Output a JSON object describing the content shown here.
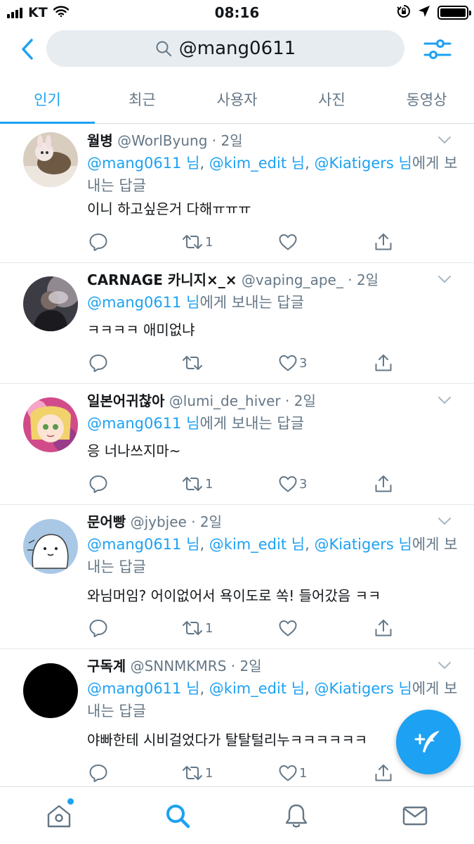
{
  "status_bar": {
    "carrier": "KT",
    "time": "08:16"
  },
  "search": {
    "query": "@mang0611"
  },
  "tabs": [
    {
      "label": "인기",
      "active": true
    },
    {
      "label": "최근",
      "active": false
    },
    {
      "label": "사용자",
      "active": false
    },
    {
      "label": "사진",
      "active": false
    },
    {
      "label": "동영상",
      "active": false
    }
  ],
  "tweets": [
    {
      "name": "월병",
      "handle": "@WorlByung",
      "time": "2일",
      "mentions": [
        "@mang0611",
        "@kim_edit",
        "@Kiatigers"
      ],
      "honorific": "님",
      "reply_suffix": "에게 보내는 답글",
      "text": "이니 하고싶은거 다해ㅠㅠㅠ",
      "replies": "",
      "retweets": "1",
      "likes": ""
    },
    {
      "name": "CARNAGE 카니지×_×",
      "handle": "@vaping_ape_",
      "time": "2일",
      "mentions": [
        "@mang0611"
      ],
      "honorific": "님",
      "reply_suffix": "에게 보내는 답글",
      "text": "ㅋㅋㅋㅋ 애미없냐",
      "replies": "",
      "retweets": "",
      "likes": "3"
    },
    {
      "name": "일본어귀찮아",
      "handle": "@lumi_de_hiver",
      "time": "2일",
      "mentions": [
        "@mang0611"
      ],
      "honorific": "님",
      "reply_suffix": "에게 보내는 답글",
      "text": "응 너나쓰지마~",
      "replies": "",
      "retweets": "1",
      "likes": "3"
    },
    {
      "name": "문어빵",
      "handle": "@jybjee",
      "time": "2일",
      "mentions": [
        "@mang0611",
        "@kim_edit",
        "@Kiatigers"
      ],
      "honorific": "님",
      "reply_suffix": "에게 보내는 답글",
      "text": "와님머임? 어이없어서 욕이도로 쏙! 들어갔음 ㅋㅋ",
      "replies": "",
      "retweets": "1",
      "likes": ""
    },
    {
      "name": "구독계",
      "handle": "@SNNMKMRS",
      "time": "2일",
      "mentions": [
        "@mang0611",
        "@kim_edit",
        "@Kiatigers"
      ],
      "honorific": "님",
      "reply_suffix": "에게 보내는 답글",
      "text": "야빠한테 시비걸었다가 탈탈털리누ㅋㅋㅋㅋㅋㅋ",
      "replies": "",
      "retweets": "1",
      "likes": "1"
    }
  ],
  "bottom_nav": [
    {
      "icon": "home-icon",
      "has_notification_dot": true
    },
    {
      "icon": "search-icon",
      "active": true
    },
    {
      "icon": "bell-icon"
    },
    {
      "icon": "mail-icon"
    }
  ],
  "colors": {
    "accent": "#1da1f2",
    "muted": "#657786",
    "text": "#14171a",
    "divider": "#e1e8ed"
  }
}
